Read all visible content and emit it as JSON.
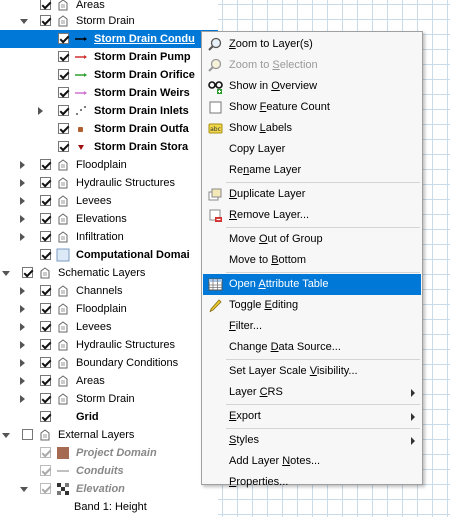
{
  "tree": [
    {
      "indent": 1,
      "arrow": "none",
      "check": true,
      "icon": "layer-group-icon",
      "label": "Areas",
      "style": ""
    },
    {
      "indent": 1,
      "arrow": "open",
      "check": true,
      "icon": "layer-group-icon",
      "label": "Storm Drain",
      "style": ""
    },
    {
      "indent": 2,
      "arrow": "none",
      "check": true,
      "icon": "line-arrow-black-icon",
      "label": "Storm Drain Condu",
      "style": "b",
      "selected": true
    },
    {
      "indent": 2,
      "arrow": "none",
      "check": true,
      "icon": "line-arrow-red-icon",
      "label": "Storm Drain Pump",
      "style": "b"
    },
    {
      "indent": 2,
      "arrow": "none",
      "check": true,
      "icon": "line-arrow-green-icon",
      "label": "Storm Drain Orifice",
      "style": "b"
    },
    {
      "indent": 2,
      "arrow": "none",
      "check": true,
      "icon": "line-arrow-pink-icon",
      "label": "Storm Drain Weirs",
      "style": "b"
    },
    {
      "indent": 2,
      "arrow": "closed",
      "check": true,
      "icon": "dots-icon",
      "label": "Storm Drain Inlets",
      "style": "b"
    },
    {
      "indent": 2,
      "arrow": "none",
      "check": true,
      "icon": "square-point-icon",
      "label": "Storm Drain Outfa",
      "style": "b"
    },
    {
      "indent": 2,
      "arrow": "none",
      "check": true,
      "icon": "triangle-point-icon",
      "label": "Storm Drain Stora",
      "style": "b"
    },
    {
      "indent": 1,
      "arrow": "closed",
      "check": true,
      "icon": "layer-group-icon",
      "label": "Floodplain",
      "style": ""
    },
    {
      "indent": 1,
      "arrow": "closed",
      "check": true,
      "icon": "layer-group-icon",
      "label": "Hydraulic Structures",
      "style": ""
    },
    {
      "indent": 1,
      "arrow": "closed",
      "check": true,
      "icon": "layer-group-icon",
      "label": "Levees",
      "style": ""
    },
    {
      "indent": 1,
      "arrow": "closed",
      "check": true,
      "icon": "layer-group-icon",
      "label": "Elevations",
      "style": ""
    },
    {
      "indent": 1,
      "arrow": "closed",
      "check": true,
      "icon": "layer-group-icon",
      "label": "Infiltration",
      "style": ""
    },
    {
      "indent": 1,
      "arrow": "none",
      "check": true,
      "icon": "polygon-icon",
      "label": "Computational Domai",
      "style": "b"
    },
    {
      "indent": 0,
      "arrow": "open",
      "check": true,
      "icon": "layer-group-icon",
      "label": "Schematic Layers",
      "style": ""
    },
    {
      "indent": 1,
      "arrow": "closed",
      "check": true,
      "icon": "layer-group-icon",
      "label": "Channels",
      "style": ""
    },
    {
      "indent": 1,
      "arrow": "closed",
      "check": true,
      "icon": "layer-group-icon",
      "label": "Floodplain",
      "style": ""
    },
    {
      "indent": 1,
      "arrow": "closed",
      "check": true,
      "icon": "layer-group-icon",
      "label": "Levees",
      "style": ""
    },
    {
      "indent": 1,
      "arrow": "closed",
      "check": true,
      "icon": "layer-group-icon",
      "label": "Hydraulic Structures",
      "style": ""
    },
    {
      "indent": 1,
      "arrow": "closed",
      "check": true,
      "icon": "layer-group-icon",
      "label": "Boundary Conditions",
      "style": ""
    },
    {
      "indent": 1,
      "arrow": "closed",
      "check": true,
      "icon": "layer-group-icon",
      "label": "Areas",
      "style": ""
    },
    {
      "indent": 1,
      "arrow": "closed",
      "check": true,
      "icon": "layer-group-icon",
      "label": "Storm Drain",
      "style": ""
    },
    {
      "indent": 1,
      "arrow": "none",
      "check": true,
      "icon": "grid-blank-icon",
      "label": "Grid",
      "style": "b"
    },
    {
      "indent": 0,
      "arrow": "open",
      "check": false,
      "icon": "layer-group-icon",
      "label": "External Layers",
      "style": ""
    },
    {
      "indent": 1,
      "arrow": "none",
      "check": true,
      "dim": true,
      "icon": "brown-fill-icon",
      "label": "Project Domain",
      "style": "it"
    },
    {
      "indent": 1,
      "arrow": "none",
      "check": true,
      "dim": true,
      "icon": "grey-line-icon",
      "label": "Conduits",
      "style": "it"
    },
    {
      "indent": 1,
      "arrow": "open",
      "check": true,
      "dim": true,
      "icon": "raster-icon",
      "label": "Elevation",
      "style": "it"
    },
    {
      "indent": 2,
      "arrow": "none",
      "check": null,
      "icon": "",
      "label": "Band 1: Height",
      "style": "plain"
    }
  ],
  "menu": [
    {
      "label": "Zoom to Layer(s)",
      "key": "Z",
      "icon": "zoom-layer-icon"
    },
    {
      "label": "Zoom to Selection",
      "key": "S",
      "icon": "zoom-selection-icon",
      "disabled": true
    },
    {
      "label": "Show in Overview",
      "key": "O",
      "icon": "overview-glasses-icon"
    },
    {
      "label": "Show Feature Count",
      "key": "F",
      "icon": "checkbox-icon"
    },
    {
      "label": "Show Labels",
      "key": "L",
      "icon": "labels-abc-icon"
    },
    {
      "label": "Copy Layer",
      "key": "",
      "icon": ""
    },
    {
      "label": "Rename Layer",
      "key": "n",
      "icon": ""
    },
    {
      "sep": true
    },
    {
      "label": "Duplicate Layer",
      "key": "D",
      "icon": "duplicate-layer-icon"
    },
    {
      "label": "Remove Layer...",
      "key": "R",
      "icon": "remove-layer-icon"
    },
    {
      "sep": true
    },
    {
      "label": "Move Out of Group",
      "key": "O",
      "icon": ""
    },
    {
      "label": "Move to Bottom",
      "key": "B",
      "icon": ""
    },
    {
      "sep": true
    },
    {
      "label": "Open Attribute Table",
      "key": "A",
      "icon": "attribute-table-icon",
      "highlighted": true
    },
    {
      "label": "Toggle Editing",
      "key": "E",
      "icon": "pencil-icon"
    },
    {
      "label": "Filter...",
      "key": "F",
      "icon": ""
    },
    {
      "label": "Change Data Source...",
      "key": "D",
      "icon": ""
    },
    {
      "sep": true
    },
    {
      "label": "Set Layer Scale Visibility...",
      "key": "V",
      "icon": ""
    },
    {
      "label": "Layer CRS",
      "key": "C",
      "icon": "",
      "submenu": true
    },
    {
      "sep": true
    },
    {
      "label": "Export",
      "key": "E",
      "icon": "",
      "submenu": true
    },
    {
      "sep": true
    },
    {
      "label": "Styles",
      "key": "S",
      "icon": "",
      "submenu": true
    },
    {
      "label": "Add Layer Notes...",
      "key": "N",
      "icon": ""
    },
    {
      "label": "Properties...",
      "key": "P",
      "icon": ""
    }
  ],
  "colors": {
    "selection": "#0078d7",
    "map_grid": "#c9dbe9"
  }
}
